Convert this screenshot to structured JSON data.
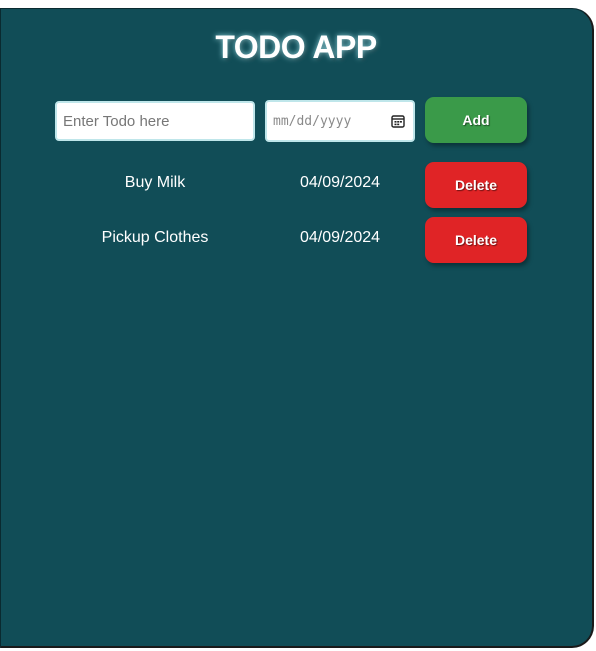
{
  "app": {
    "title": "TODO APP"
  },
  "form": {
    "todo_placeholder": "Enter Todo here",
    "date_placeholder": "mm/dd/yyyy",
    "add_label": "Add"
  },
  "todos": [
    {
      "name": "Buy Milk",
      "date": "04/09/2024",
      "delete_label": "Delete"
    },
    {
      "name": "Pickup Clothes",
      "date": "04/09/2024",
      "delete_label": "Delete"
    }
  ],
  "icons": {
    "date_picker": "calendar-icon"
  },
  "colors": {
    "background": "#114d57",
    "add_button": "#3a9a49",
    "delete_button": "#e02426",
    "text": "#ffffff"
  }
}
